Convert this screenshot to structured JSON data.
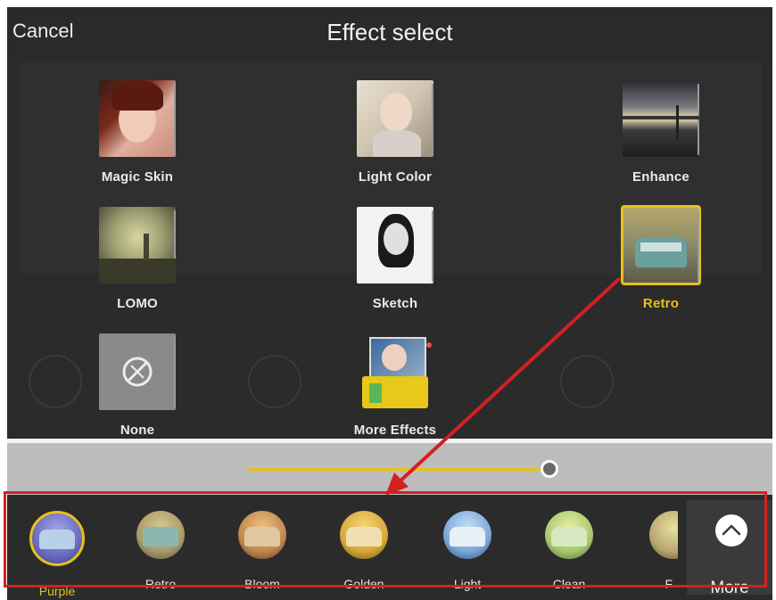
{
  "header": {
    "cancel_label": "Cancel",
    "title": "Effect select"
  },
  "effects": [
    {
      "label": "Magic Skin",
      "selected": false
    },
    {
      "label": "Light Color",
      "selected": false
    },
    {
      "label": "Enhance",
      "selected": false
    },
    {
      "label": "LOMO",
      "selected": false
    },
    {
      "label": "Sketch",
      "selected": false
    },
    {
      "label": "Retro",
      "selected": true
    },
    {
      "label": "None",
      "selected": false
    },
    {
      "label": "More Effects",
      "selected": false
    }
  ],
  "intensity_slider": {
    "value_fraction": 0.95
  },
  "filters": [
    {
      "label": "Purple",
      "selected": true
    },
    {
      "label": "Retro",
      "selected": false
    },
    {
      "label": "Bloom",
      "selected": false
    },
    {
      "label": "Golden",
      "selected": false
    },
    {
      "label": "Light",
      "selected": false
    },
    {
      "label": "Clean",
      "selected": false
    },
    {
      "label": "F",
      "selected": false
    }
  ],
  "more_button": {
    "label": "More"
  },
  "colors": {
    "accent": "#e8c01a",
    "annotation_red": "#d42020",
    "background": "#2b2b2b"
  }
}
